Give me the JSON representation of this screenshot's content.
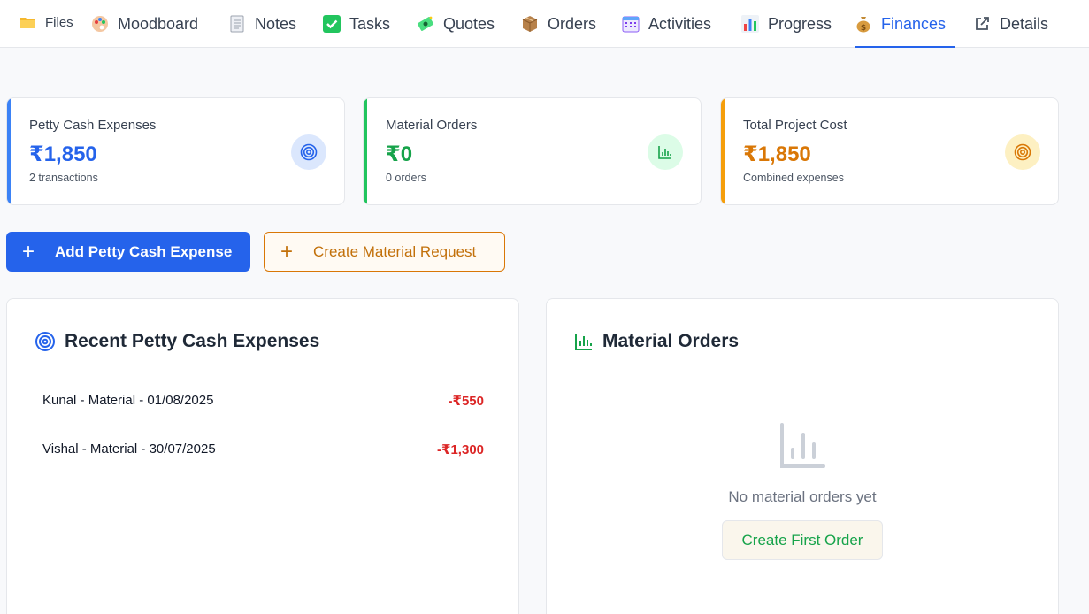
{
  "tabs": [
    {
      "label": "Files",
      "icon": "folder-icon"
    },
    {
      "label": "Moodboard",
      "icon": "palette-icon"
    },
    {
      "label": "Notes",
      "icon": "notepad-icon"
    },
    {
      "label": "Tasks",
      "icon": "checkbox-icon"
    },
    {
      "label": "Quotes",
      "icon": "money-icon"
    },
    {
      "label": "Orders",
      "icon": "package-icon"
    },
    {
      "label": "Activities",
      "icon": "calendar-icon"
    },
    {
      "label": "Progress",
      "icon": "bar-chart-icon"
    },
    {
      "label": "Finances",
      "icon": "money-bag-icon"
    },
    {
      "label": "Details",
      "icon": "external-link-icon"
    }
  ],
  "active_tab": "Finances",
  "stats": {
    "petty": {
      "label": "Petty Cash Expenses",
      "value": "₹1,850",
      "sub": "2 transactions",
      "accent": "#3b82f6",
      "icon": "target-icon"
    },
    "material": {
      "label": "Material Orders",
      "value": "₹0",
      "sub": "0 orders",
      "accent": "#22c55e",
      "icon": "bar-chart-icon"
    },
    "total": {
      "label": "Total Project Cost",
      "value": "₹1,850",
      "sub": "Combined expenses",
      "accent": "#f59e0b",
      "icon": "target-icon"
    }
  },
  "actions": {
    "add_petty": "Add Petty Cash Expense",
    "create_request": "Create Material Request"
  },
  "recent_panel": {
    "title": "Recent Petty Cash Expenses",
    "expenses": [
      {
        "description": "Kunal - Material - 01/08/2025",
        "amount": "-₹550"
      },
      {
        "description": "Vishal - Material - 30/07/2025",
        "amount": "-₹1,300"
      }
    ]
  },
  "orders_panel": {
    "title": "Material Orders",
    "empty_text": "No material orders yet",
    "create_first": "Create First Order"
  },
  "colors": {
    "primary": "#2563eb",
    "green": "#16a34a",
    "orange": "#d97706",
    "red": "#dc2626"
  }
}
